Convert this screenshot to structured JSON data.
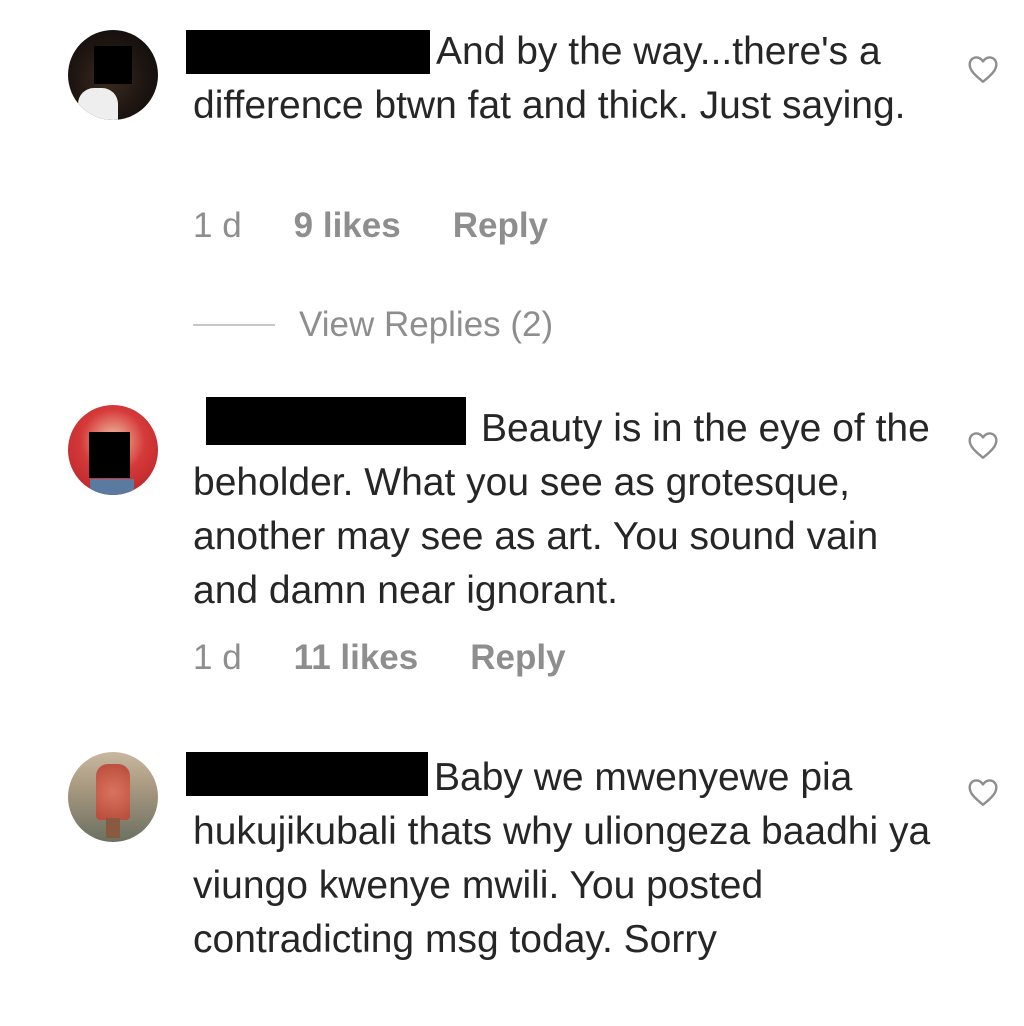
{
  "comments": [
    {
      "text": "And by the way...there's a difference btwn fat and thick. Just saying.",
      "time": "1 d",
      "likes": "9 likes",
      "reply": "Reply",
      "view_replies": "View Replies (2)"
    },
    {
      "text": "Beauty is in the eye of the beholder. What you see as grot­esque, another may see as art. You sound vain and damn near ignorant.",
      "time": "1 d",
      "likes": "11 likes",
      "reply": "Reply"
    },
    {
      "text": "Baby we mwenyewe pia hukujikubali thats why uliongeza baadhi ya viungo kwenye mwili. You posted contradicting msg today. Sorry"
    }
  ],
  "icons": {
    "like": "heart-outline-icon"
  },
  "colors": {
    "text": "#262626",
    "meta": "#8e8e8e",
    "redaction": "#000000"
  }
}
